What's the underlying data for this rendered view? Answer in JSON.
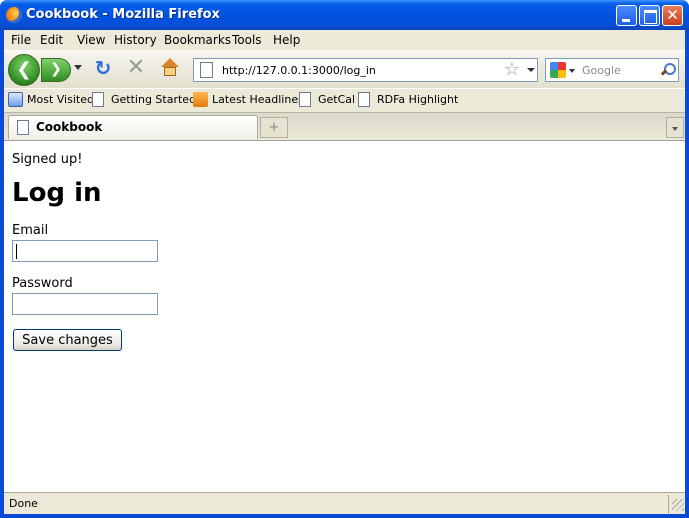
{
  "window": {
    "title": "Cookbook - Mozilla Firefox",
    "close_glyph": "✕"
  },
  "menu": [
    "File",
    "Edit",
    "View",
    "History",
    "Bookmarks",
    "Tools",
    "Help"
  ],
  "nav": {
    "back_glyph": "❮",
    "forward_glyph": "❯",
    "reload_glyph": "↻",
    "stop_glyph": "✕",
    "star_glyph": "☆",
    "url": "http://127.0.0.1:3000/log_in",
    "search_placeholder": "Google"
  },
  "bookmarks": [
    {
      "label": "Most Visited",
      "icon": "smart-folder-icon"
    },
    {
      "label": "Getting Started",
      "icon": "page-icon"
    },
    {
      "label": "Latest Headlines",
      "icon": "rss-icon"
    },
    {
      "label": "GetCal",
      "icon": "page-icon"
    },
    {
      "label": "RDFa Highlight",
      "icon": "page-icon"
    }
  ],
  "tabs": [
    {
      "label": "Cookbook"
    }
  ],
  "newtab_glyph": "+",
  "page": {
    "flash": "Signed up!",
    "heading": "Log in",
    "email_label": "Email",
    "email_value": "",
    "password_label": "Password",
    "password_value": "",
    "submit_label": "Save changes"
  },
  "status": "Done"
}
